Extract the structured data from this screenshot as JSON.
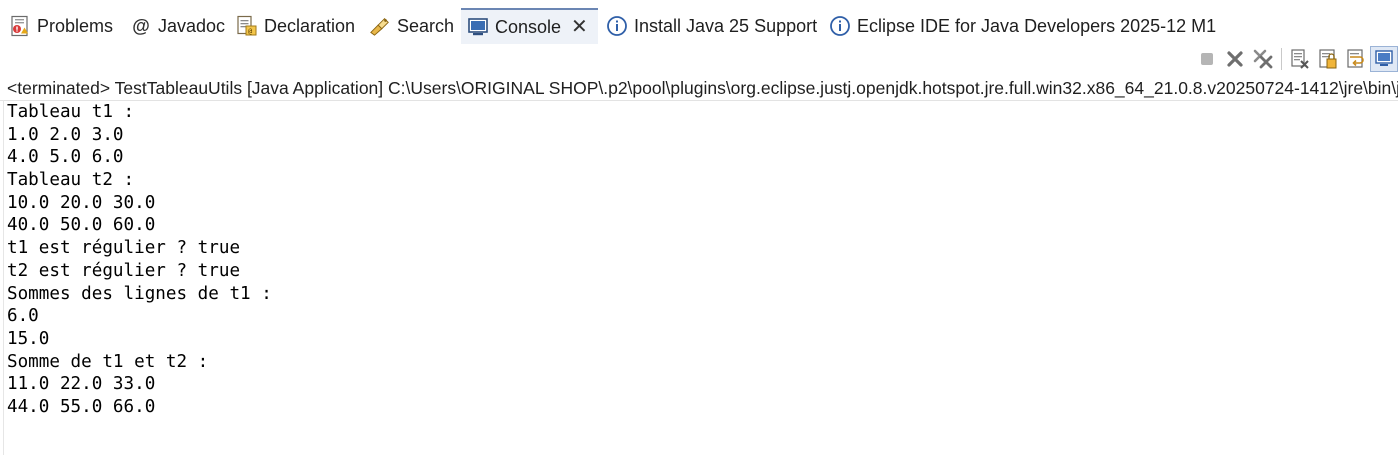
{
  "tabs": [
    {
      "label": "Problems",
      "icon": "problems-icon"
    },
    {
      "label": "Javadoc",
      "icon": "javadoc-icon"
    },
    {
      "label": "Declaration",
      "icon": "declaration-icon"
    },
    {
      "label": "Search",
      "icon": "search-icon"
    },
    {
      "label": "Console",
      "icon": "console-icon",
      "active": true
    },
    {
      "label": "Install Java 25 Support",
      "icon": "info-icon"
    },
    {
      "label": "Eclipse IDE for Java Developers 2025-12 M1",
      "icon": "info-icon"
    }
  ],
  "toolbar": {
    "buttons": [
      "terminate-icon",
      "remove-launch-icon",
      "remove-all-terminated-icon",
      "clear-console-icon",
      "scroll-lock-icon",
      "word-wrap-icon",
      "pin-console-icon"
    ]
  },
  "console": {
    "header": "<terminated> TestTableauUtils [Java Application] C:\\Users\\ORIGINAL SHOP\\.p2\\pool\\plugins\\org.eclipse.justj.openjdk.hotspot.jre.full.win32.x86_64_21.0.8.v20250724-1412\\jre\\bin\\javaw.exe",
    "lines": [
      "Tableau t1 :",
      "1.0 2.0 3.0",
      "4.0 5.0 6.0",
      "Tableau t2 :",
      "10.0 20.0 30.0",
      "40.0 50.0 60.0",
      "t1 est régulier ? true",
      "t2 est régulier ? true",
      "Sommes des lignes de t1 :",
      "6.0",
      "15.0",
      "Somme de t1 et t2 :",
      "11.0 22.0 33.0",
      "44.0 55.0 66.0"
    ]
  },
  "colors": {
    "active_tab_bg": "#eef2f8",
    "active_tab_border": "#6b86b3",
    "info_blue": "#2f5fa8",
    "output_text": "#000000"
  }
}
